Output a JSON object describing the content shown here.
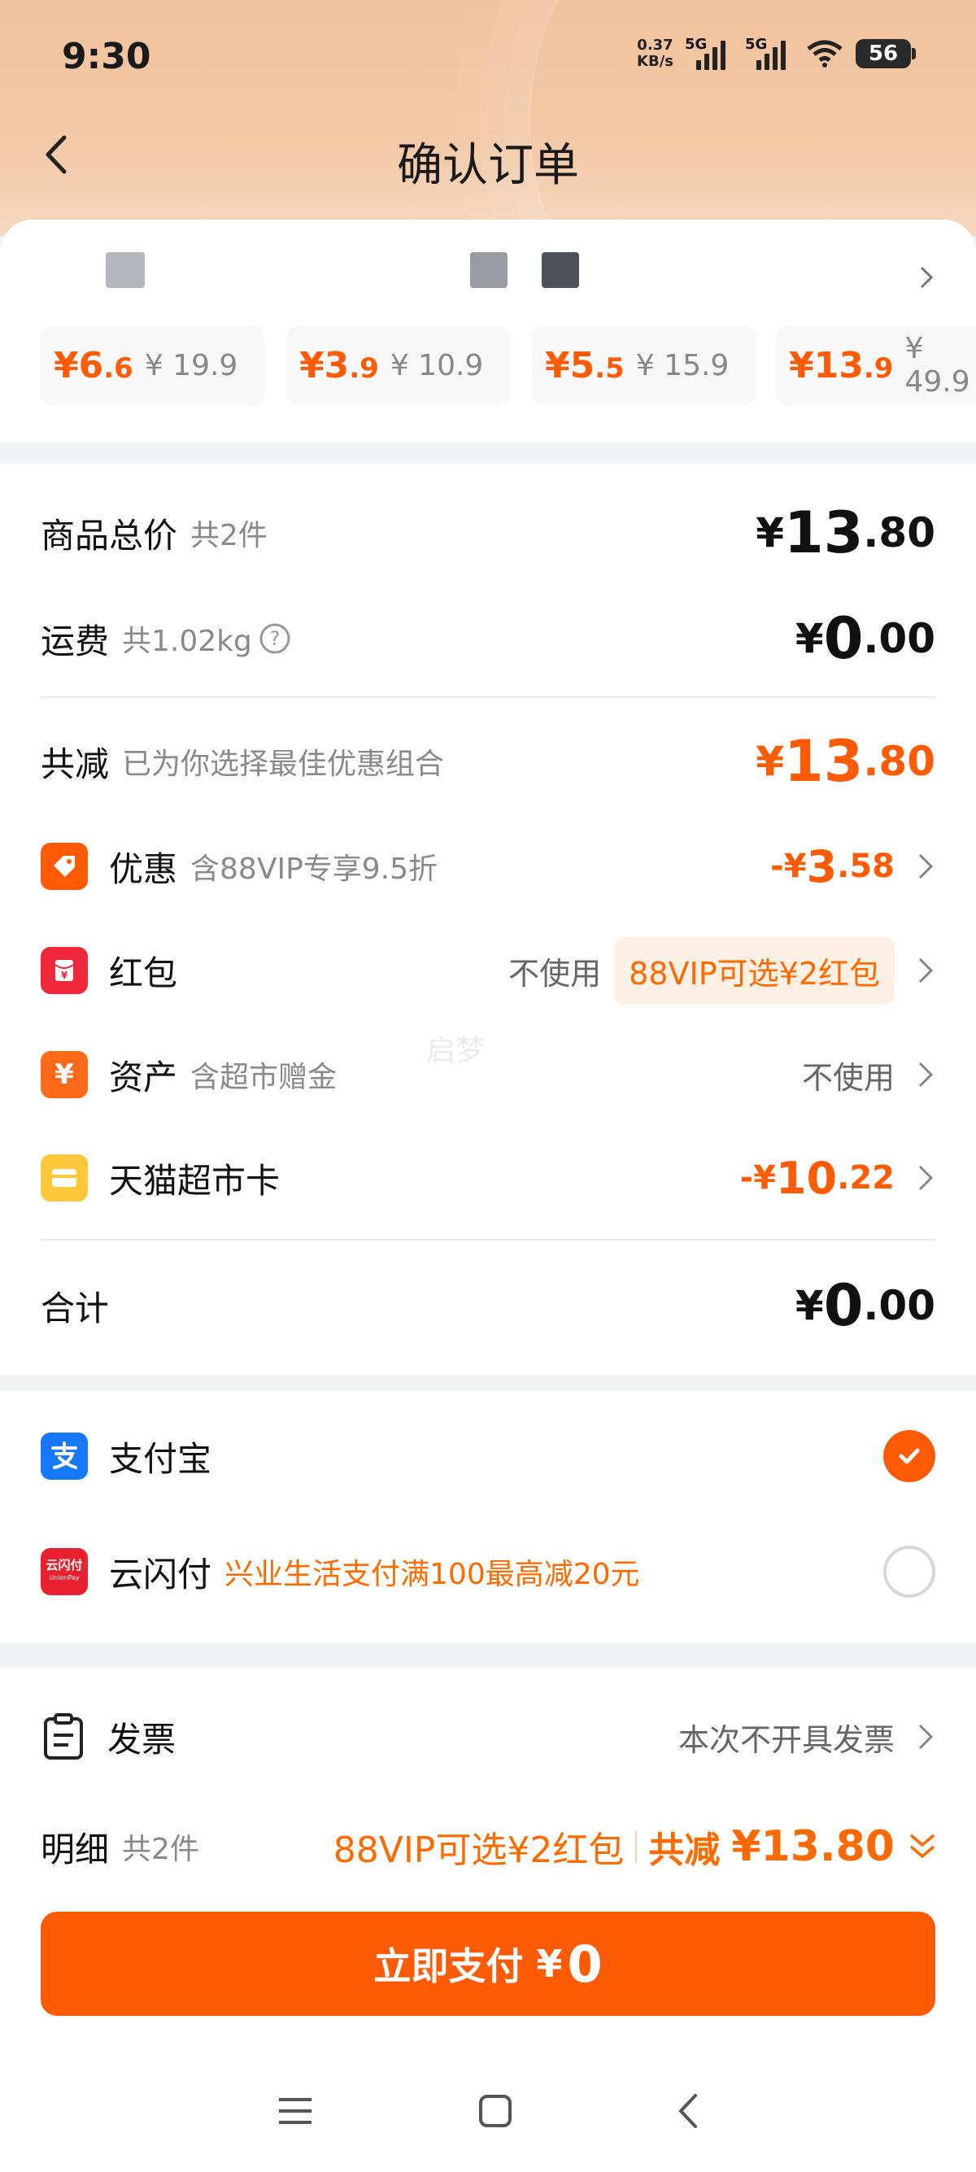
{
  "status_bar": {
    "time": "9:30",
    "net_speed_top": "0.37",
    "net_speed_bottom": "KB/s",
    "sim1": "5G",
    "sim2": "5G",
    "battery": "56"
  },
  "header": {
    "title": "确认订单"
  },
  "products": [
    {
      "sale_price_int": "¥6",
      "sale_price_dec": ".6",
      "orig_price": "¥ 19.9"
    },
    {
      "sale_price_int": "¥3",
      "sale_price_dec": ".9",
      "orig_price": "¥ 10.9"
    },
    {
      "sale_price_int": "¥5",
      "sale_price_dec": ".5",
      "orig_price": "¥ 15.9"
    },
    {
      "sale_price_int": "¥13",
      "sale_price_dec": ".9",
      "orig_price": "¥ 49.9"
    }
  ],
  "summary": {
    "goods_total": {
      "label": "商品总价",
      "sub": "共2件",
      "yen": "¥",
      "int": "13",
      "dec": ".80"
    },
    "shipping": {
      "label": "运费",
      "sub": "共1.02kg",
      "yen": "¥",
      "int": "0",
      "dec": ".00"
    },
    "total_discount": {
      "label": "共减",
      "sub": "已为你选择最佳优惠组合",
      "yen": "¥",
      "int": "13",
      "dec": ".80"
    },
    "promo": {
      "label": "优惠",
      "sub": "含88VIP专享9.5折",
      "sign": "-¥",
      "int": "3",
      "dec": ".58"
    },
    "redpacket": {
      "label": "红包",
      "value": "不使用",
      "pill": "88VIP可选¥2红包"
    },
    "assets": {
      "label": "资产",
      "sub": "含超市赠金",
      "value": "不使用"
    },
    "tmall_card": {
      "label": "天猫超市卡",
      "sign": "-¥",
      "int": "10",
      "dec": ".22"
    },
    "grand_total": {
      "label": "合计",
      "yen": "¥",
      "int": "0",
      "dec": ".00"
    }
  },
  "payment": {
    "alipay": {
      "label": "支付宝",
      "icon": "alipay-icon",
      "selected": true
    },
    "unionpay": {
      "label": "云闪付",
      "icon_text": "云闪付",
      "icon_sub": "UnionPay",
      "promo": "兴业生活支付满100最高减20元",
      "selected": false
    }
  },
  "invoice": {
    "label": "发票",
    "value": "本次不开具发票"
  },
  "detail": {
    "label": "明细",
    "sub": "共2件",
    "vip": "88VIP可选¥2红包",
    "discount_label": "共减",
    "discount_value": "¥13.80"
  },
  "pay_button": {
    "label": "立即支付",
    "yen": "¥",
    "amount": "0"
  },
  "watermark": "启梦",
  "colors": {
    "accent": "#ff5b05",
    "header_bg": "#f1c29d"
  }
}
